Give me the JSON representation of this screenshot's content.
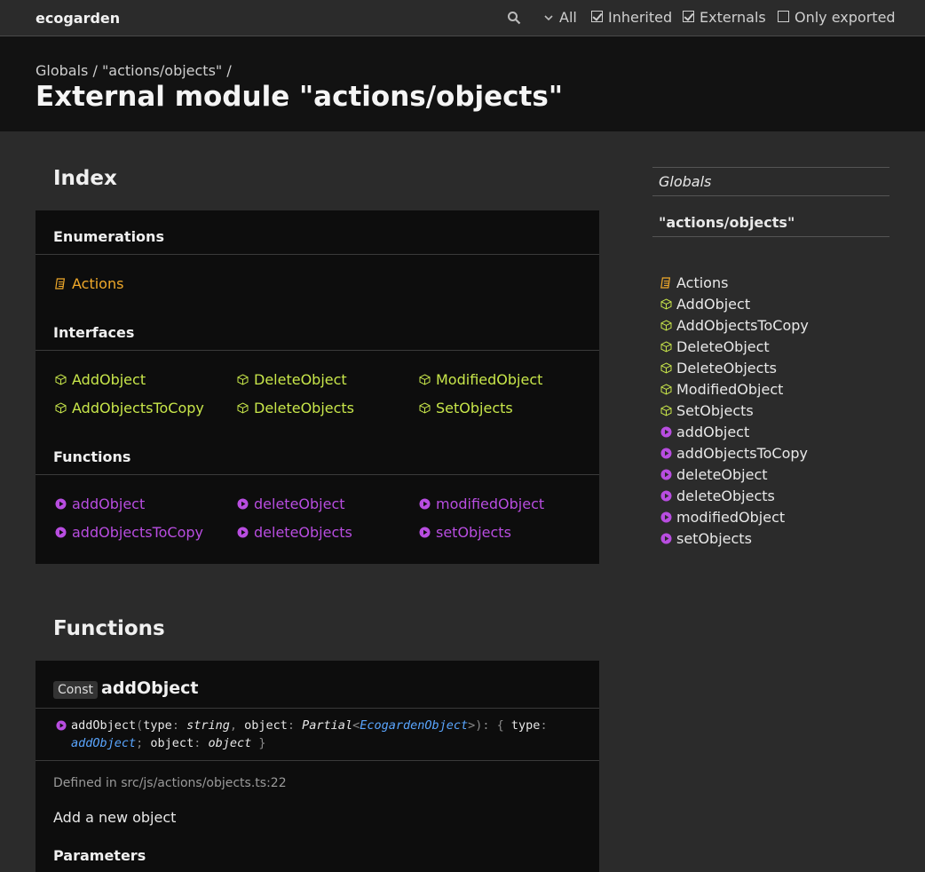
{
  "topbar": {
    "brand": "ecogarden",
    "filters": {
      "visibility": "All",
      "inherited": "Inherited",
      "externals": "Externals",
      "only_exported": "Only exported"
    }
  },
  "header": {
    "breadcrumb": "Globals / \"actions/objects\" /",
    "title": "External module \"actions/objects\""
  },
  "index": {
    "heading": "Index",
    "enumerations_title": "Enumerations",
    "enumerations": [
      "Actions"
    ],
    "interfaces_title": "Interfaces",
    "interfaces": [
      "AddObject",
      "DeleteObject",
      "ModifiedObject",
      "AddObjectsToCopy",
      "DeleteObjects",
      "SetObjects"
    ],
    "functions_title": "Functions",
    "functions": [
      "addObject",
      "deleteObject",
      "modifiedObject",
      "addObjectsToCopy",
      "deleteObjects",
      "setObjects"
    ]
  },
  "functions_section": {
    "heading": "Functions",
    "badge": "Const",
    "name": "addObject",
    "sig": {
      "name": "addObject",
      "open": "(",
      "p1": "type",
      "colon": ": ",
      "p1_type": "string",
      "comma": ", ",
      "p2": "object",
      "p2_type": "Partial",
      "lt": "<",
      "p2_generic": "EcogardenObject",
      "gt": ">",
      "close": "): {",
      "r1": " type",
      "r1_type": "addObject",
      "semi": ";",
      "r2": " object",
      "r2_type": "object",
      "end": " }"
    },
    "defined_in": "Defined in src/js/actions/objects.ts:22",
    "description": "Add a new object",
    "parameters_title": "Parameters"
  },
  "sidebar": {
    "globals": "Globals",
    "module": "\"actions/objects\"",
    "items": [
      {
        "label": "Actions",
        "kind": "enum"
      },
      {
        "label": "AddObject",
        "kind": "interface"
      },
      {
        "label": "AddObjectsToCopy",
        "kind": "interface"
      },
      {
        "label": "DeleteObject",
        "kind": "interface"
      },
      {
        "label": "DeleteObjects",
        "kind": "interface"
      },
      {
        "label": "ModifiedObject",
        "kind": "interface"
      },
      {
        "label": "SetObjects",
        "kind": "interface"
      },
      {
        "label": "addObject",
        "kind": "function"
      },
      {
        "label": "addObjectsToCopy",
        "kind": "function"
      },
      {
        "label": "deleteObject",
        "kind": "function"
      },
      {
        "label": "deleteObjects",
        "kind": "function"
      },
      {
        "label": "modifiedObject",
        "kind": "function"
      },
      {
        "label": "setObjects",
        "kind": "function"
      }
    ]
  },
  "colors": {
    "enum": "#f0a92a",
    "interface": "#c8e64a",
    "function": "#b84de0",
    "type_link": "#5aa6ff"
  }
}
